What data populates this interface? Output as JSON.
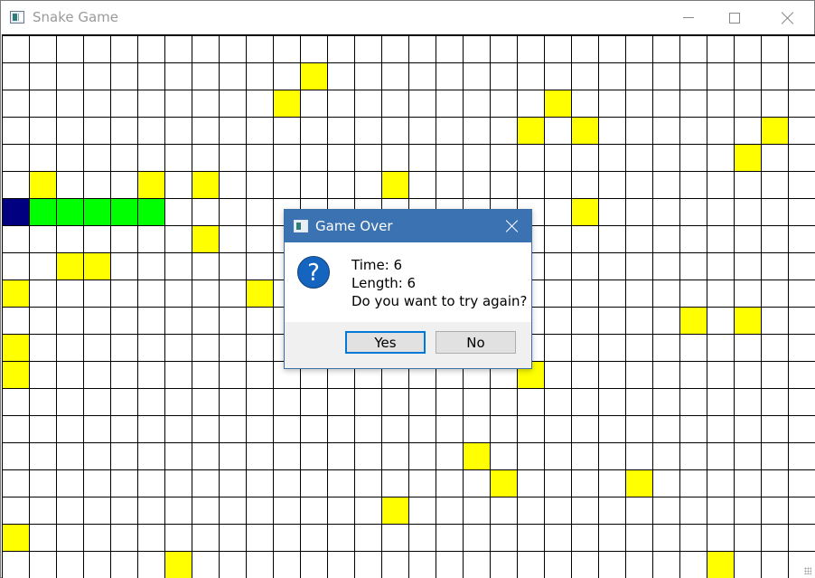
{
  "window": {
    "title": "Snake Game"
  },
  "board": {
    "columns": 30,
    "rows": 20,
    "colors": {
      "food": "#ffff00",
      "snake_body": "#00ff00",
      "snake_head": "#000080",
      "grid": "#000000"
    },
    "food": [
      [
        11,
        1
      ],
      [
        10,
        2
      ],
      [
        20,
        2
      ],
      [
        19,
        3
      ],
      [
        21,
        3
      ],
      [
        28,
        3
      ],
      [
        27,
        4
      ],
      [
        1,
        5
      ],
      [
        5,
        5
      ],
      [
        7,
        5
      ],
      [
        14,
        5
      ],
      [
        21,
        6
      ],
      [
        7,
        7
      ],
      [
        2,
        8
      ],
      [
        3,
        8
      ],
      [
        0,
        9
      ],
      [
        9,
        9
      ],
      [
        25,
        10
      ],
      [
        27,
        10
      ],
      [
        0,
        11
      ],
      [
        0,
        12
      ],
      [
        19,
        12
      ],
      [
        17,
        15
      ],
      [
        18,
        16
      ],
      [
        23,
        16
      ],
      [
        14,
        17
      ],
      [
        0,
        18
      ],
      [
        6,
        19
      ],
      [
        26,
        19
      ]
    ],
    "snake_head": [
      0,
      6
    ],
    "snake_body": [
      [
        1,
        6
      ],
      [
        2,
        6
      ],
      [
        3,
        6
      ],
      [
        4,
        6
      ],
      [
        5,
        6
      ]
    ]
  },
  "dialog": {
    "title": "Game Over",
    "icon": "question-icon",
    "lines": [
      "Time: 6",
      "Length: 6",
      "Do you want to try again?"
    ],
    "yes_label": "Yes",
    "no_label": "No"
  }
}
